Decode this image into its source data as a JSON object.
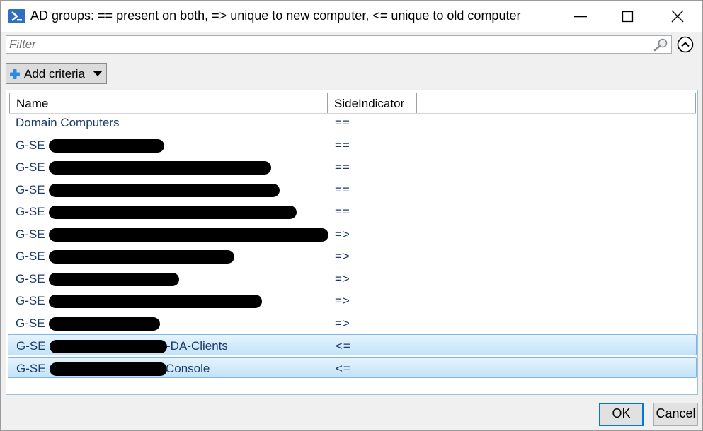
{
  "window": {
    "title": "AD groups: == present on both, => unique to new computer, <= unique to old computer",
    "app_icon": "powershell-icon",
    "controls": [
      "minimize-icon",
      "maximize-icon",
      "close-icon"
    ]
  },
  "filter": {
    "placeholder": "Filter",
    "value": "",
    "search_icon": "search-icon",
    "collapse_icon": "chevron-up-circle-icon"
  },
  "toolbar": {
    "add_criteria_label": "Add criteria",
    "add_icon": "plus-icon",
    "dropdown_icon": "caret-down-icon"
  },
  "grid": {
    "columns": [
      "Name",
      "SideIndicator"
    ],
    "rows": [
      {
        "name_prefix": "Domain Computers",
        "name_suffix": "",
        "side": "==",
        "selected": false,
        "redacted": false
      },
      {
        "name_prefix": "G-SE",
        "name_suffix": "",
        "side": "==",
        "selected": false,
        "redacted": true
      },
      {
        "name_prefix": "G-SE",
        "name_suffix": "",
        "side": "==",
        "selected": false,
        "redacted": true
      },
      {
        "name_prefix": "G-SE",
        "name_suffix": "",
        "side": "==",
        "selected": false,
        "redacted": true
      },
      {
        "name_prefix": "G-SE",
        "name_suffix": "",
        "side": "==",
        "selected": false,
        "redacted": true
      },
      {
        "name_prefix": "G-SE",
        "name_suffix": "",
        "side": "=>",
        "selected": false,
        "redacted": true
      },
      {
        "name_prefix": "G-SE",
        "name_suffix": "",
        "side": "=>",
        "selected": false,
        "redacted": true
      },
      {
        "name_prefix": "G-SE",
        "name_suffix": "",
        "side": "=>",
        "selected": false,
        "redacted": true
      },
      {
        "name_prefix": "G-SE",
        "name_suffix": "",
        "side": "=>",
        "selected": false,
        "redacted": true
      },
      {
        "name_prefix": "G-SE",
        "name_suffix": "",
        "side": "=>",
        "selected": false,
        "redacted": true
      },
      {
        "name_prefix": "G-SE",
        "name_suffix": "-DA-Clients",
        "side": "<=",
        "selected": true,
        "redacted": true
      },
      {
        "name_prefix": "G-SE",
        "name_suffix": "Console",
        "side": "<=",
        "selected": true,
        "redacted": true
      }
    ]
  },
  "footer": {
    "ok_label": "OK",
    "cancel_label": "Cancel"
  },
  "colors": {
    "accent": "#0078d7",
    "selection": "#c3e3f8",
    "row_text": "#1c3a6e"
  }
}
